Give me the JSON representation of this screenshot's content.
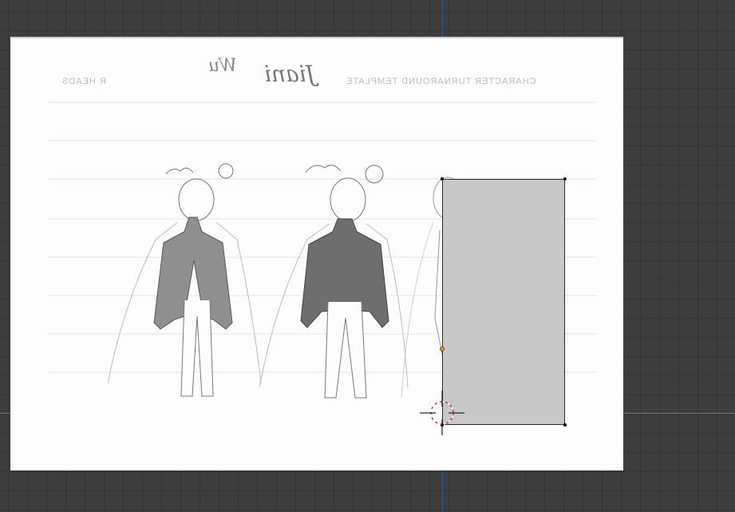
{
  "viewport": {
    "grid_color": "#3d3d3d",
    "axis_y_color": "#2c5f96",
    "axis_x_color": "#6d8e2a"
  },
  "reference_image": {
    "header_title": "CHARACTER TURNAROUND TEMPLATE",
    "header_left": "R HEADS",
    "signature": "Jiani",
    "initials": "Wu"
  },
  "plane": {
    "fill": "#c6c6c6",
    "origin_color": "#e6982a"
  },
  "cursor": {
    "icon": "3d-cursor-icon"
  }
}
